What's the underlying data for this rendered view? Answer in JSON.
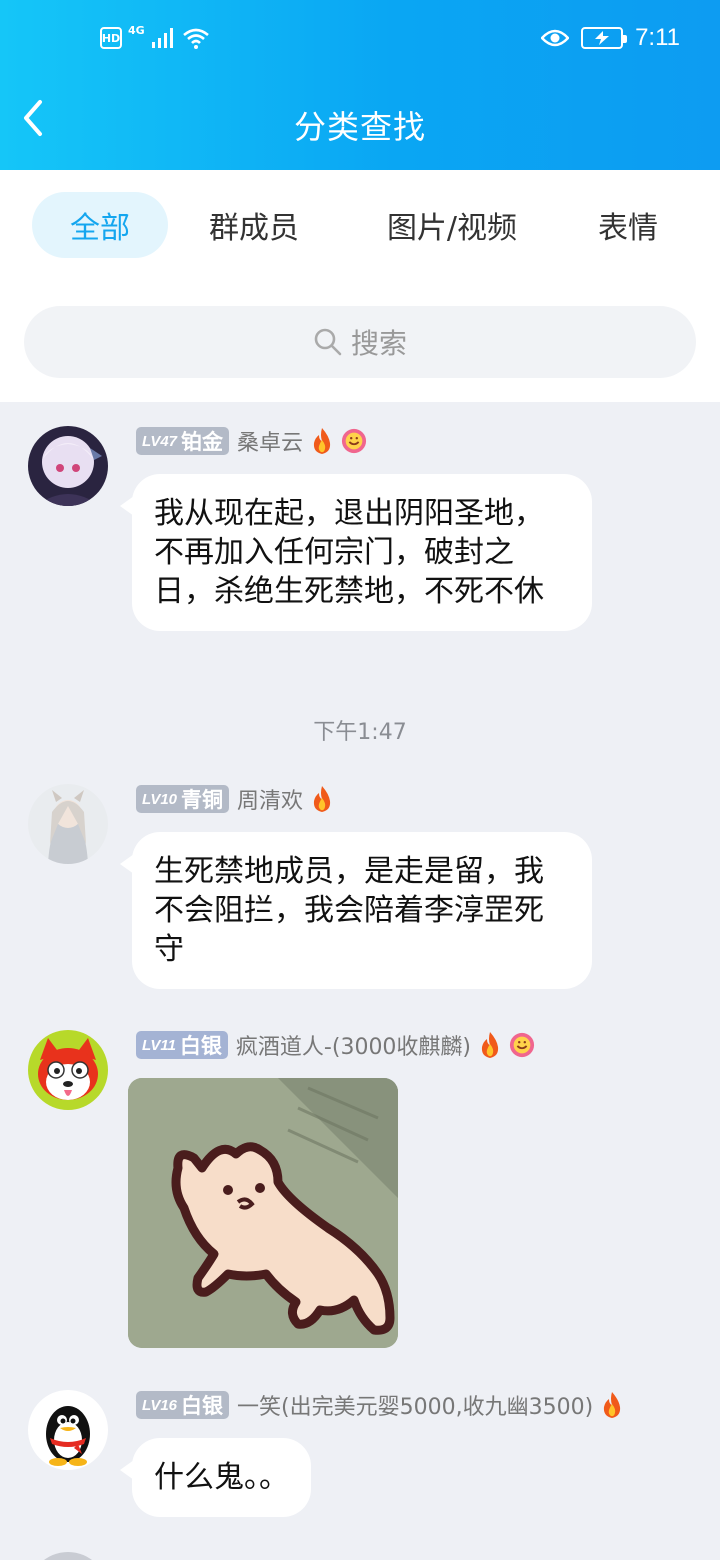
{
  "status_bar": {
    "hd_label": "HD",
    "network_label": "4G",
    "time": "7:11"
  },
  "header": {
    "title": "分类查找"
  },
  "tabs": [
    {
      "label": "全部",
      "active": true
    },
    {
      "label": "群成员",
      "active": false
    },
    {
      "label": "图片/视频",
      "active": false
    },
    {
      "label": "表情",
      "active": false
    }
  ],
  "search": {
    "placeholder": "搜索"
  },
  "messages": [
    {
      "level": "LV47",
      "rank": "铂金",
      "sender": "桑卓云",
      "text": "我从现在起，退出阴阳圣地，不再加入任何宗门，破封之日，杀绝生死禁地，不死不休"
    },
    {
      "level": "LV10",
      "rank": "青铜",
      "sender": "周清欢",
      "text": "生死禁地成员，是走是留，我不会阻拦，我会陪着李淳罡死守"
    },
    {
      "level": "LV11",
      "rank": "白银",
      "sender": "疯酒道人-(3000收麒麟)",
      "image": "cat-sticker"
    },
    {
      "level": "LV16",
      "rank": "白银",
      "sender": "一笑(出完美元婴5000,收九幽3500)",
      "text": "什么鬼。。"
    }
  ],
  "timestamp": "下午1:47",
  "colors": {
    "header_start": "#15c6f8",
    "header_end": "#0d9cf2",
    "tab_active_bg": "#e3f5fd",
    "tab_active_text": "#14a6ef",
    "chat_bg": "#eef0f5",
    "badge_bronze_platinum": "#b3bac7",
    "badge_silver": "#a4b3d4"
  }
}
